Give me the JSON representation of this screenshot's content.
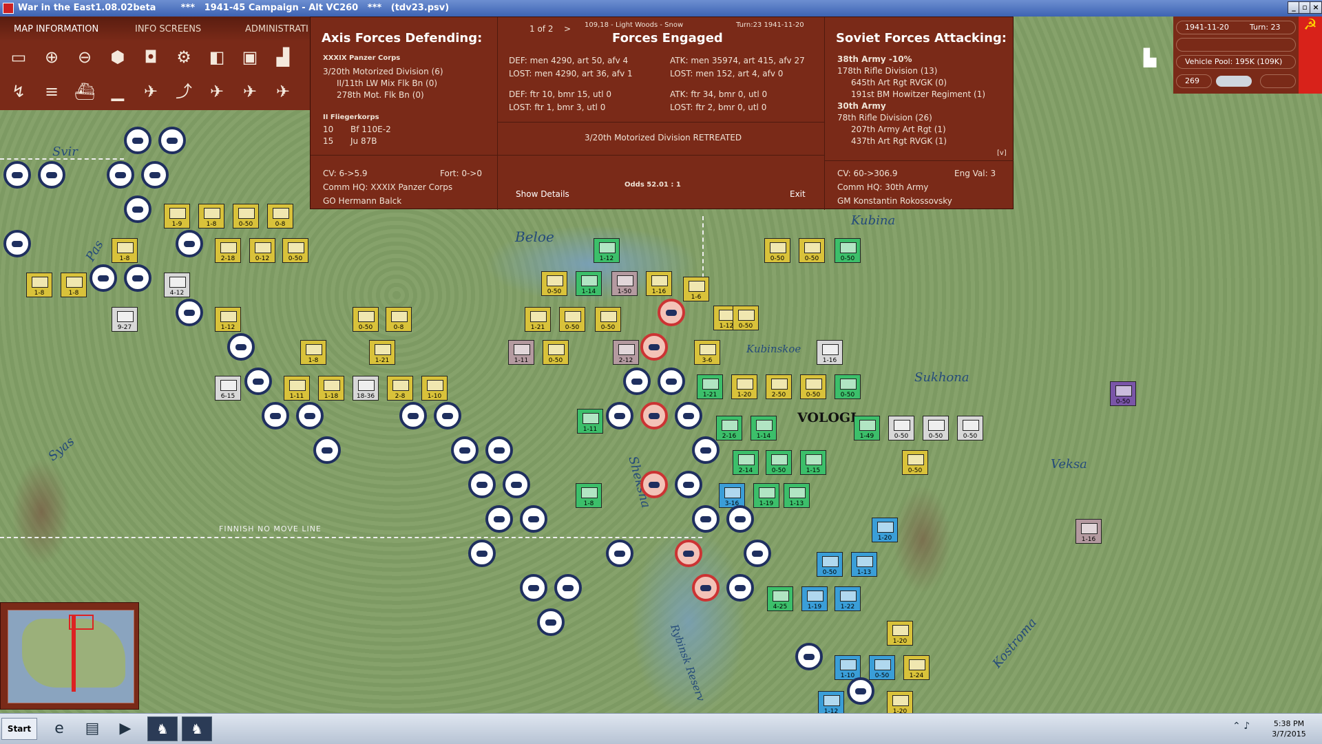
{
  "window": {
    "title": "War in the East1.08.02beta        ***   1941-45 Campaign - Alt VC260   ***   (tdv23.psv)",
    "controls": [
      "_",
      "▫",
      "×"
    ]
  },
  "toolbar": {
    "tabs": [
      "MAP INFORMATION",
      "INFO SCREENS",
      "ADMINISTRATI"
    ]
  },
  "combat": {
    "axis": {
      "title": "Axis Forces Defending:",
      "corps": "XXXIX Panzer Corps",
      "units": [
        "3/20th Motorized Division (6)",
        "II/11th LW Mix Flk Bn (0)",
        "278th Mot. Flk Bn (0)"
      ],
      "air_group": "II Fliegerkorps",
      "aircraft": [
        {
          "count": "10",
          "type": "Bf 110E-2"
        },
        {
          "count": "15",
          "type": "Ju 87B"
        }
      ],
      "cv": "CV: 6->5.9",
      "fort": "Fort: 0->0",
      "hq": "Comm HQ: XXXIX Panzer Corps",
      "leader": "GO Hermann Balck"
    },
    "mid": {
      "page": "1 of 2",
      "next": ">",
      "hex": "109,18 - Light Woods - Snow",
      "turn": "Turn:23  1941-11-20",
      "title": "Forces Engaged",
      "def1": "DEF: men 4290, art 50, afv 4",
      "atk1": "ATK: men 35974, art 415, afv 27",
      "lost1d": "LOST: men 4290, art 36, afv 1",
      "lost1a": "LOST: men 152, art 4, afv 0",
      "def2": "DEF: ftr 10, bmr 15, utl 0",
      "atk2": "ATK: ftr 34, bmr 0, utl 0",
      "lost2d": "LOST: ftr 1, bmr 3, utl 0",
      "lost2a": "LOST: ftr 2, bmr 0, utl 0",
      "result": "3/20th Motorized Division RETREATED",
      "show_details": "Show Details",
      "odds": "Odds 52.01 : 1",
      "exit": "Exit"
    },
    "soviet": {
      "title": "Soviet Forces Attacking:",
      "army1": "38th Army  -10%",
      "units1": [
        "178th Rifle Division (13)",
        "645th Art Rgt RVGK (0)",
        "191st BM Howitzer Regiment (1)"
      ],
      "army2": "30th Army",
      "units2": [
        "78th Rifle Division (26)",
        "207th Army Art Rgt (1)",
        "437th Art Rgt RVGK (1)"
      ],
      "expand": "[v]",
      "cv": "CV: 60->306.9",
      "eng": "Eng Val: 3",
      "hq": "Comm HQ: 30th Army",
      "leader": "GM Konstantin Rokossovsky"
    }
  },
  "right_panel": {
    "date": "1941-11-20",
    "turn": "Turn: 23",
    "vehicle_pool": "Vehicle Pool: 195K (109K)",
    "value": "269"
  },
  "map": {
    "labels": [
      "Beloe",
      "Kubina",
      "Kubinskoe",
      "Sukhona",
      "Veksa",
      "Kostroma",
      "Syas",
      "Svir",
      "Pas",
      "Sheksna",
      "Rybinsk Reserv"
    ],
    "city": "VOLOGI",
    "no_move_line": "FINNISH NO MOVE LINE",
    "counter_values": [
      "1-12",
      "0-50",
      "1-14",
      "1-50",
      "1-16",
      "1-6",
      "0-50",
      "0-50",
      "0-50",
      "1-21",
      "0-50",
      "0-50",
      "1-11",
      "0-50",
      "2-12",
      "3-6",
      "1-12",
      "1-16",
      "0-50",
      "1-21",
      "1-20",
      "2-50",
      "0-50",
      "0-50",
      "1-11",
      "1-9",
      "1-8",
      "2-16",
      "1-14",
      "1-49",
      "0-50",
      "0-50",
      "0-50",
      "2-14",
      "0-50",
      "1-15",
      "0-50",
      "1-8",
      "3-16",
      "1-19",
      "1-13",
      "1-20",
      "0-50",
      "1-13",
      "4-25",
      "1-19",
      "1-22",
      "1-20",
      "1-10",
      "0-50",
      "1-24",
      "1-12",
      "1-20",
      "1-16",
      "0-50",
      "1-8",
      "2-18",
      "0-12",
      "0-50",
      "1-12",
      "0-50",
      "0-8",
      "1-8",
      "1-21",
      "6-15",
      "1-11",
      "1-18",
      "18-36",
      "2-8",
      "1-10",
      "9-27",
      "4-12",
      "1-8",
      "1-8",
      "1-9",
      "1-8",
      "0-50",
      "0-8"
    ]
  },
  "taskbar": {
    "start": "Start",
    "time": "5:38 PM",
    "date": "3/7/2015"
  }
}
